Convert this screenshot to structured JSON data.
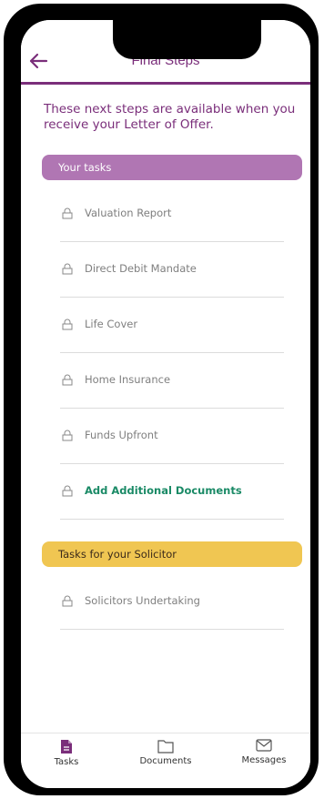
{
  "header": {
    "title": "Final Steps"
  },
  "intro_text": "These next steps are available when you receive your Letter of Offer.",
  "sections": {
    "your_tasks": {
      "title": "Your tasks",
      "color": "#b076b3",
      "items": [
        {
          "label": "Valuation Report"
        },
        {
          "label": "Direct Debit Mandate"
        },
        {
          "label": "Life Cover"
        },
        {
          "label": "Home Insurance"
        },
        {
          "label": "Funds Upfront"
        },
        {
          "label": "Add Additional Documents"
        }
      ]
    },
    "solicitor_tasks": {
      "title": "Tasks for your Solicitor",
      "color": "#f0c652",
      "items": [
        {
          "label": "Solicitors Undertaking"
        }
      ]
    }
  },
  "tabbar": {
    "tabs": [
      {
        "label": "Tasks",
        "icon": "document-filled-icon",
        "active": true
      },
      {
        "label": "Documents",
        "icon": "folder-icon",
        "active": false
      },
      {
        "label": "Messages",
        "icon": "envelope-icon",
        "active": false
      }
    ]
  },
  "colors": {
    "brand": "#7a2e7a",
    "accent_green": "#1a8a66"
  }
}
